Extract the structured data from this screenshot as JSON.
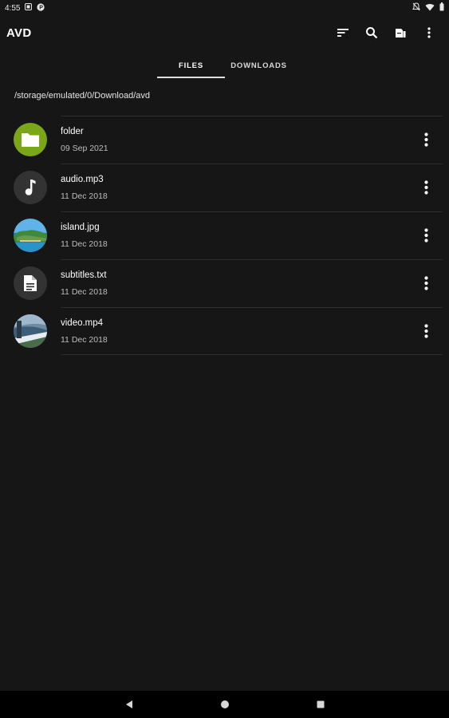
{
  "status_bar": {
    "time": "4:55",
    "icons": [
      "notification-icon",
      "p-app-icon",
      "mute-icon",
      "wifi-icon",
      "battery-icon"
    ]
  },
  "app_bar": {
    "title": "AVD",
    "actions": [
      "sort-icon",
      "search-icon",
      "storage-icon",
      "overflow-menu-icon"
    ]
  },
  "tabs": [
    {
      "label": "FILES",
      "active": true
    },
    {
      "label": "DOWNLOADS",
      "active": false
    }
  ],
  "path": "/storage/emulated/0/Download/avd",
  "files": [
    {
      "name": "folder",
      "date": "09 Sep 2021",
      "type": "folder",
      "icon": "folder-icon"
    },
    {
      "name": "audio.mp3",
      "date": "11 Dec 2018",
      "type": "audio",
      "icon": "music-note-icon"
    },
    {
      "name": "island.jpg",
      "date": "11 Dec 2018",
      "type": "image",
      "icon": "island-thumbnail"
    },
    {
      "name": "subtitles.txt",
      "date": "11 Dec 2018",
      "type": "text",
      "icon": "document-icon"
    },
    {
      "name": "video.mp4",
      "date": "11 Dec 2018",
      "type": "video",
      "icon": "video-thumbnail"
    }
  ],
  "nav_bar": {
    "buttons": [
      "back-icon",
      "home-icon",
      "recents-icon"
    ]
  },
  "colors": {
    "background": "#161616",
    "folder_accent": "#7aa617",
    "icon_circle": "#333333",
    "nav_background": "#000000"
  }
}
